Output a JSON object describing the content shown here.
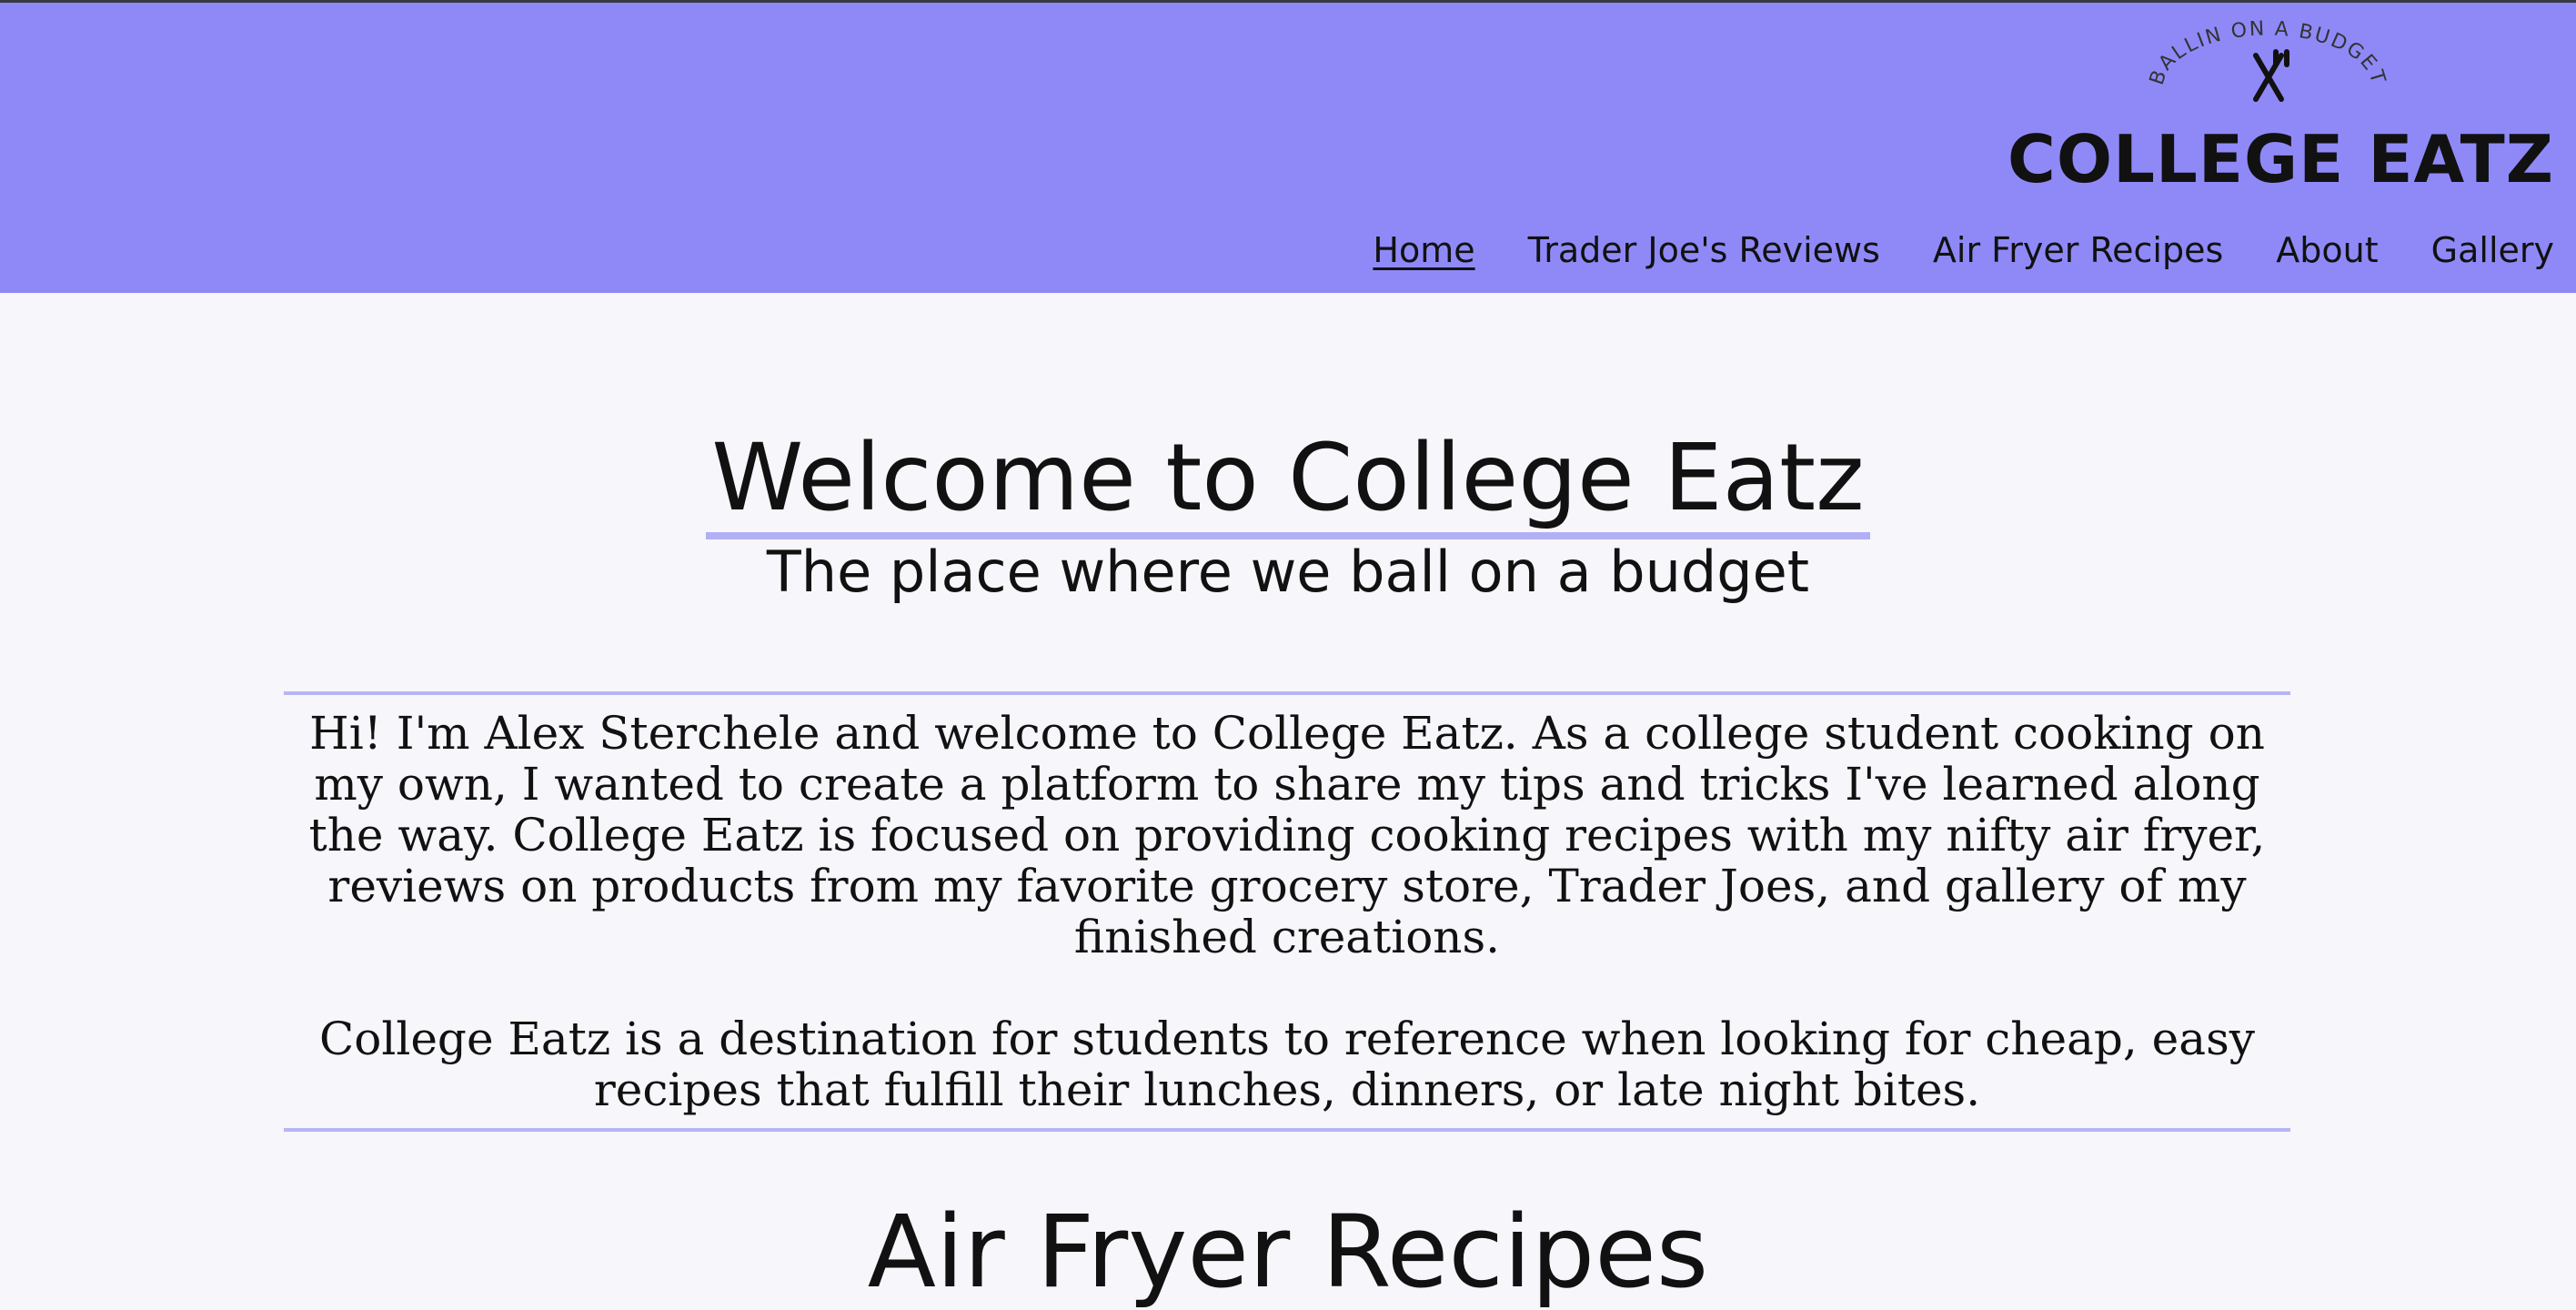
{
  "header": {
    "logo_tagline": "BALLIN ON A BUDGET",
    "logo_title": "COLLEGE EATZ",
    "background": "#8f89f8"
  },
  "nav": {
    "items": [
      {
        "label": "Home",
        "active": true
      },
      {
        "label": "Trader Joe's Reviews"
      },
      {
        "label": "Air Fryer Recipes"
      },
      {
        "label": "About"
      },
      {
        "label": "Gallery"
      }
    ]
  },
  "main": {
    "title": "Welcome to College Eatz",
    "tagline": "The place where we ball on a budget",
    "intro": [
      "Hi! I'm Alex Sterchele and welcome to College Eatz. As a college student cooking on my own, I wanted to create a platform to share my tips and tricks I've learned along the way. College Eatz is focused on providing cooking recipes with my nifty air fryer, reviews on products from my favorite grocery store, Trader Joes, and gallery of my finished creations.",
      "College Eatz is a destination for students to reference when looking for cheap, easy recipes that fulfill their lunches, dinners, or late night bites."
    ],
    "section_title": "Air Fryer Recipes"
  },
  "icons": {
    "logo_icon": "fork-knife-icon"
  },
  "colors": {
    "accent_line": "#b7b5f2",
    "page_background": "#f6f6fb"
  }
}
